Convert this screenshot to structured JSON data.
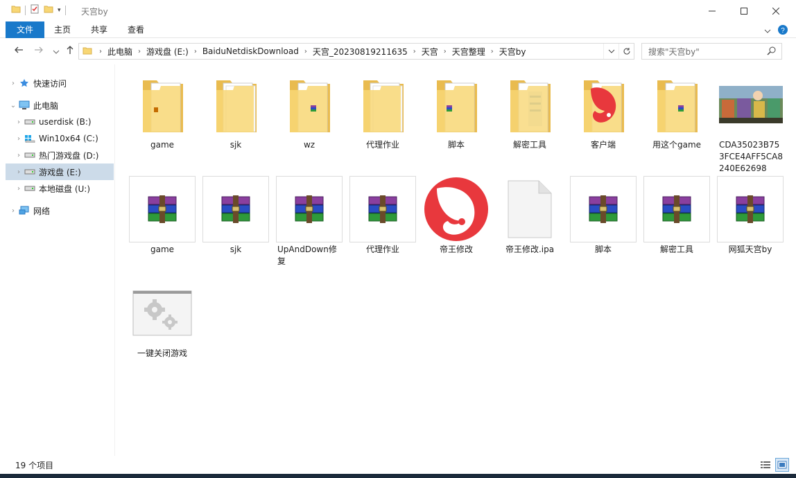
{
  "window": {
    "title": "天宫by"
  },
  "ribbon": {
    "tabs": [
      "文件",
      "主页",
      "共享",
      "查看"
    ]
  },
  "address": {
    "crumbs": [
      "此电脑",
      "游戏盘 (E:)",
      "BaiduNetdiskDownload",
      "天宫_20230819211635",
      "天宫",
      "天宫整理",
      "天宫by"
    ]
  },
  "search": {
    "placeholder": "搜索\"天宫by\""
  },
  "navpane": {
    "quick_access": "快速访问",
    "this_pc": "此电脑",
    "drives": [
      "userdisk (B:)",
      "Win10x64 (C:)",
      "热门游戏盘 (D:)",
      "游戏盘 (E:)",
      "本地磁盘 (U:)"
    ],
    "network": "网络"
  },
  "items": [
    {
      "name": "game",
      "kind": "folder",
      "overlay": "doc"
    },
    {
      "name": "sjk",
      "kind": "folder",
      "overlay": "paper"
    },
    {
      "name": "wz",
      "kind": "folder",
      "overlay": "rar"
    },
    {
      "name": "代理作业",
      "kind": "folder",
      "overlay": "paper"
    },
    {
      "name": "脚本",
      "kind": "folder",
      "overlay": "rar"
    },
    {
      "name": "解密工具",
      "kind": "folder",
      "overlay": "blue"
    },
    {
      "name": "客户端",
      "kind": "folder",
      "overlay": "red"
    },
    {
      "name": "用这个game",
      "kind": "folder",
      "overlay": "rar"
    },
    {
      "name": "CDA35023B753FCE4AFF5CA8240E62698",
      "kind": "image"
    },
    {
      "name": "game",
      "kind": "rar"
    },
    {
      "name": "sjk",
      "kind": "rar"
    },
    {
      "name": "UpAndDown修复",
      "kind": "rar"
    },
    {
      "name": "代理作业",
      "kind": "rar"
    },
    {
      "name": "帝王修改",
      "kind": "app"
    },
    {
      "name": "帝王修改.ipa",
      "kind": "file"
    },
    {
      "name": "脚本",
      "kind": "rar"
    },
    {
      "name": "解密工具",
      "kind": "rar"
    },
    {
      "name": "网狐天宫by",
      "kind": "rar"
    },
    {
      "name": "一键关闭游戏",
      "kind": "bat"
    }
  ],
  "status": {
    "count": "19 个项目"
  },
  "colors": {
    "accent": "#1979ca",
    "folder": "#f8d775",
    "selected": "#ccdbe9",
    "brand_red": "#e8383d"
  }
}
